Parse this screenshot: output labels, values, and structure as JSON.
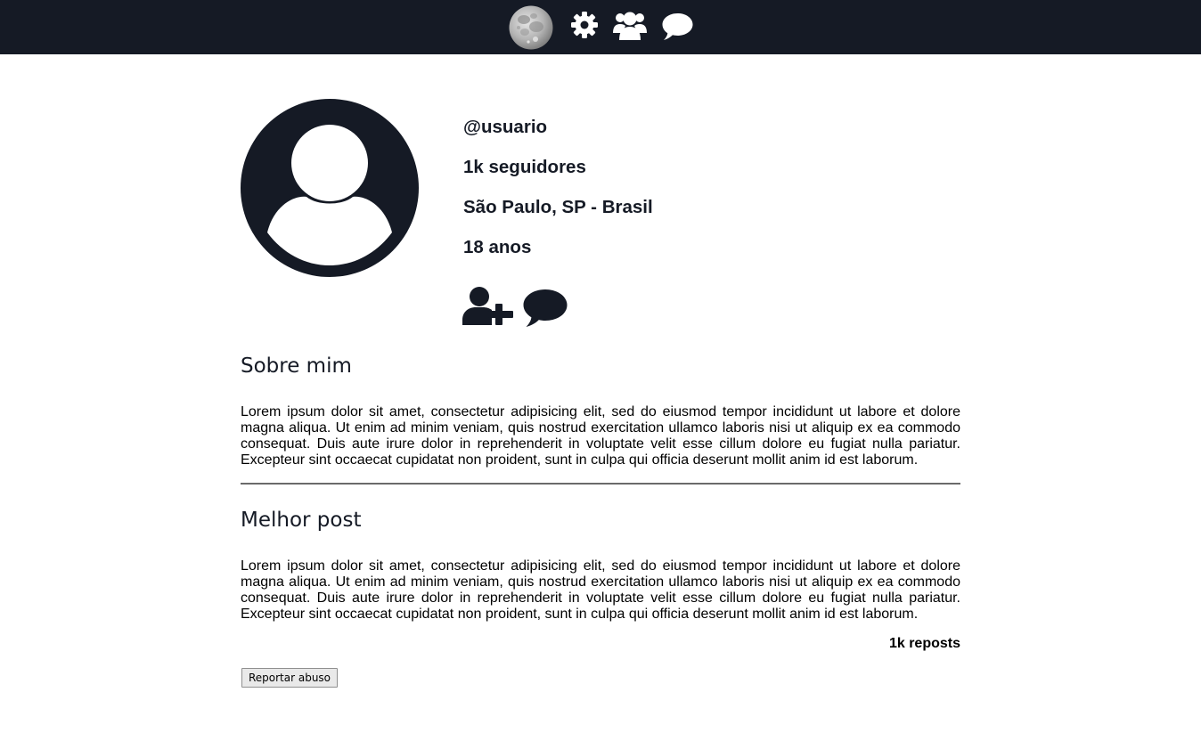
{
  "colors": {
    "topbar_bg": "#151a25",
    "icon_light": "#ffffff",
    "icon_dark": "#151a25",
    "divider": "#6a6a6a"
  },
  "nav": {
    "icons": [
      "moon-icon",
      "gear-icon",
      "users-icon",
      "chat-icon"
    ]
  },
  "profile": {
    "avatar_icon": "user-avatar-icon",
    "username": "@usuario",
    "followers": "1k seguidores",
    "location": "São Paulo, SP - Brasil",
    "age": "18 anos",
    "action_icons": [
      "add-user-icon",
      "message-icon"
    ]
  },
  "about": {
    "title": "Sobre mim",
    "text": "Lorem ipsum dolor sit amet, consectetur adipisicing elit, sed do eiusmod tempor incididunt ut labore et dolore magna aliqua. Ut enim ad minim veniam, quis nostrud exercitation ullamco laboris nisi ut aliquip ex ea commodo consequat. Duis aute irure dolor in reprehenderit in voluptate velit esse cillum dolore eu fugiat nulla pariatur. Excepteur sint occaecat cupidatat non proident, sunt in culpa qui officia deserunt mollit anim id est laborum."
  },
  "best_post": {
    "title": "Melhor post",
    "text": "Lorem ipsum dolor sit amet, consectetur adipisicing elit, sed do eiusmod tempor incididunt ut labore et dolore magna aliqua. Ut enim ad minim veniam, quis nostrud exercitation ullamco laboris nisi ut aliquip ex ea commodo consequat. Duis aute irure dolor in reprehenderit in voluptate velit esse cillum dolore eu fugiat nulla pariatur. Excepteur sint occaecat cupidatat non proident, sunt in culpa qui officia deserunt mollit anim id est laborum.",
    "reposts": "1k reposts"
  },
  "report_button": "Reportar abuso"
}
